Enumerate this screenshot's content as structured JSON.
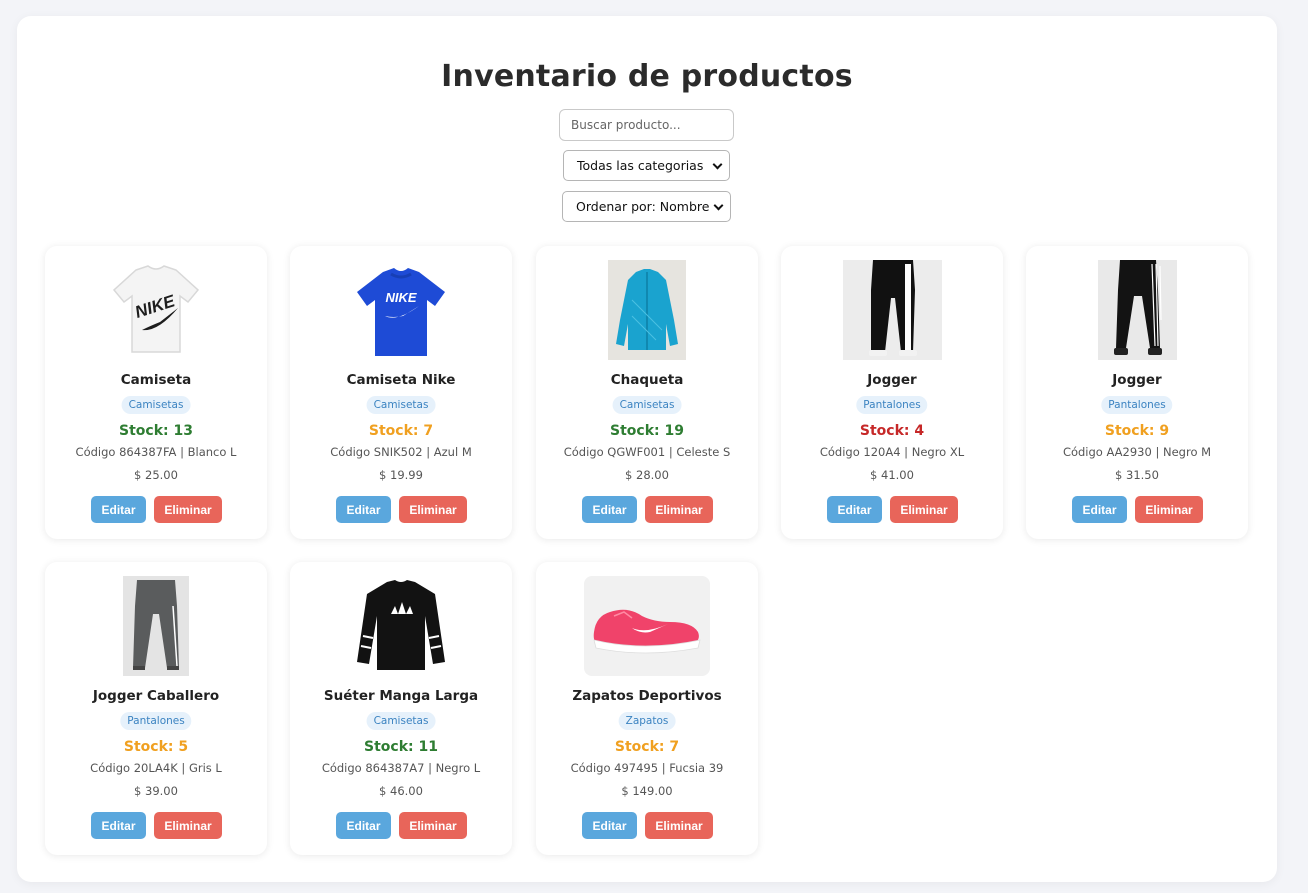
{
  "page": {
    "title": "Inventario de productos",
    "search_placeholder": "Buscar producto...",
    "category_filter": "Todas las categorias",
    "sort_filter": "Ordenar por: Nombre"
  },
  "colors": {
    "stock_high": "#2e7d32",
    "stock_medium": "#f0a020",
    "stock_low": "#c62828",
    "edit_button": "#5aa7dd",
    "delete_button": "#e8655a",
    "category_badge_bg": "#e6f1fb",
    "category_badge_text": "#3b83c1"
  },
  "products": [
    {
      "name": "Camiseta",
      "category": "Camisetas",
      "stock": "Stock: 13",
      "stock_level": "high",
      "details": "Código 864387FA | Blanco L",
      "price": "$ 25.00",
      "image": "white-nike-tshirt",
      "edit_label": "Editar",
      "delete_label": "Eliminar"
    },
    {
      "name": "Camiseta Nike",
      "category": "Camisetas",
      "stock": "Stock: 7",
      "stock_level": "medium",
      "details": "Código SNIK502 | Azul M",
      "price": "$ 19.99",
      "image": "blue-nike-tshirt",
      "edit_label": "Editar",
      "delete_label": "Eliminar"
    },
    {
      "name": "Chaqueta",
      "category": "Camisetas",
      "stock": "Stock: 19",
      "stock_level": "high",
      "details": "Código QGWF001 | Celeste S",
      "price": "$ 28.00",
      "image": "light-blue-jacket",
      "edit_label": "Editar",
      "delete_label": "Eliminar"
    },
    {
      "name": "Jogger",
      "category": "Pantalones",
      "stock": "Stock: 4",
      "stock_level": "low",
      "details": "Código 120A4 | Negro XL",
      "price": "$ 41.00",
      "image": "black-jogger-white-stripe",
      "edit_label": "Editar",
      "delete_label": "Eliminar"
    },
    {
      "name": "Jogger",
      "category": "Pantalones",
      "stock": "Stock: 9",
      "stock_level": "medium",
      "details": "Código AA2930 | Negro M",
      "price": "$ 31.50",
      "image": "black-jogger-three-stripes",
      "edit_label": "Editar",
      "delete_label": "Eliminar"
    },
    {
      "name": "Jogger Caballero",
      "category": "Pantalones",
      "stock": "Stock: 5",
      "stock_level": "medium",
      "details": "Código 20LA4K | Gris L",
      "price": "$ 39.00",
      "image": "grey-jogger",
      "edit_label": "Editar",
      "delete_label": "Eliminar"
    },
    {
      "name": "Suéter Manga Larga",
      "category": "Camisetas",
      "stock": "Stock: 11",
      "stock_level": "high",
      "details": "Código 864387A7 | Negro L",
      "price": "$ 46.00",
      "image": "black-long-sleeve",
      "edit_label": "Editar",
      "delete_label": "Eliminar"
    },
    {
      "name": "Zapatos Deportivos",
      "category": "Zapatos",
      "stock": "Stock: 7",
      "stock_level": "medium",
      "details": "Código 497495 | Fucsia 39",
      "price": "$ 149.00",
      "image": "pink-running-shoe",
      "edit_label": "Editar",
      "delete_label": "Eliminar"
    }
  ]
}
